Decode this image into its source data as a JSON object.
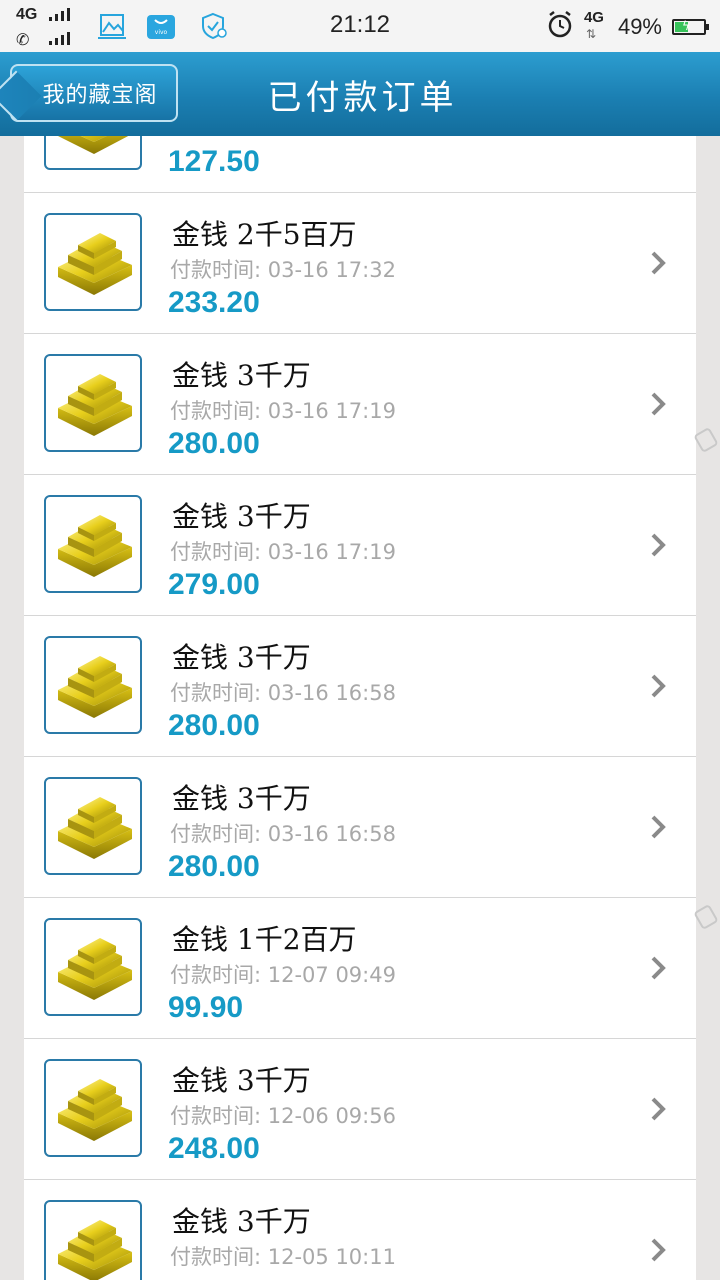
{
  "status_bar": {
    "network_label": "4G",
    "time": "21:12",
    "data_label": "4G",
    "battery_percent": "49%",
    "battery_level": 0.49,
    "icons": [
      "signal-icon",
      "phone-icon",
      "gallery-icon",
      "vivo-store-icon",
      "shield-icon",
      "alarm-icon",
      "data-arrows-icon",
      "battery-icon"
    ]
  },
  "header": {
    "back_label": "我的藏宝阁",
    "title": "已付款订单"
  },
  "orders": [
    {
      "name": "",
      "time": "",
      "price": "127.50"
    },
    {
      "name": "金钱  2千5百万",
      "time": "付款时间: 03-16 17:32",
      "price": "233.20"
    },
    {
      "name": "金钱  3千万",
      "time": "付款时间: 03-16 17:19",
      "price": "280.00"
    },
    {
      "name": "金钱  3千万",
      "time": "付款时间: 03-16 17:19",
      "price": "279.00"
    },
    {
      "name": "金钱  3千万",
      "time": "付款时间: 03-16 16:58",
      "price": "280.00"
    },
    {
      "name": "金钱  3千万",
      "time": "付款时间: 03-16 16:58",
      "price": "280.00"
    },
    {
      "name": "金钱  1千2百万",
      "time": "付款时间: 12-07 09:49",
      "price": "99.90"
    },
    {
      "name": "金钱  3千万",
      "time": "付款时间: 12-06 09:56",
      "price": "248.00"
    },
    {
      "name": "金钱  3千万",
      "time": "付款时间: 12-05 10:11",
      "price": ""
    }
  ],
  "colors": {
    "header_blue": "#1b7fb2",
    "price_blue": "#169ac6",
    "thumb_border": "#2a7aa8",
    "gold": "#e8cf1c"
  }
}
